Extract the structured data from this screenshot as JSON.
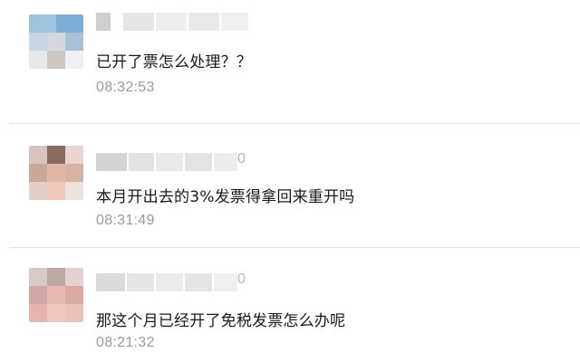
{
  "comments": [
    {
      "message": "已开了票怎么处理？？",
      "time": "08:32:53",
      "name_tail": ""
    },
    {
      "message": "本月开出去的3%发票得拿回来重开吗",
      "time": "08:31:49",
      "name_tail": "0"
    },
    {
      "message": "那这个月已经开了免税发票怎么办呢",
      "time": "08:21:32",
      "name_tail": "0"
    }
  ],
  "colors": {
    "divider": "#e6e6e6",
    "time_text": "#9a9a9a",
    "message_text": "#1a1a1a",
    "redaction": "#d9d9d9"
  },
  "icons": {
    "avatar": "pixelated-avatar",
    "name": "pixelated-username"
  }
}
